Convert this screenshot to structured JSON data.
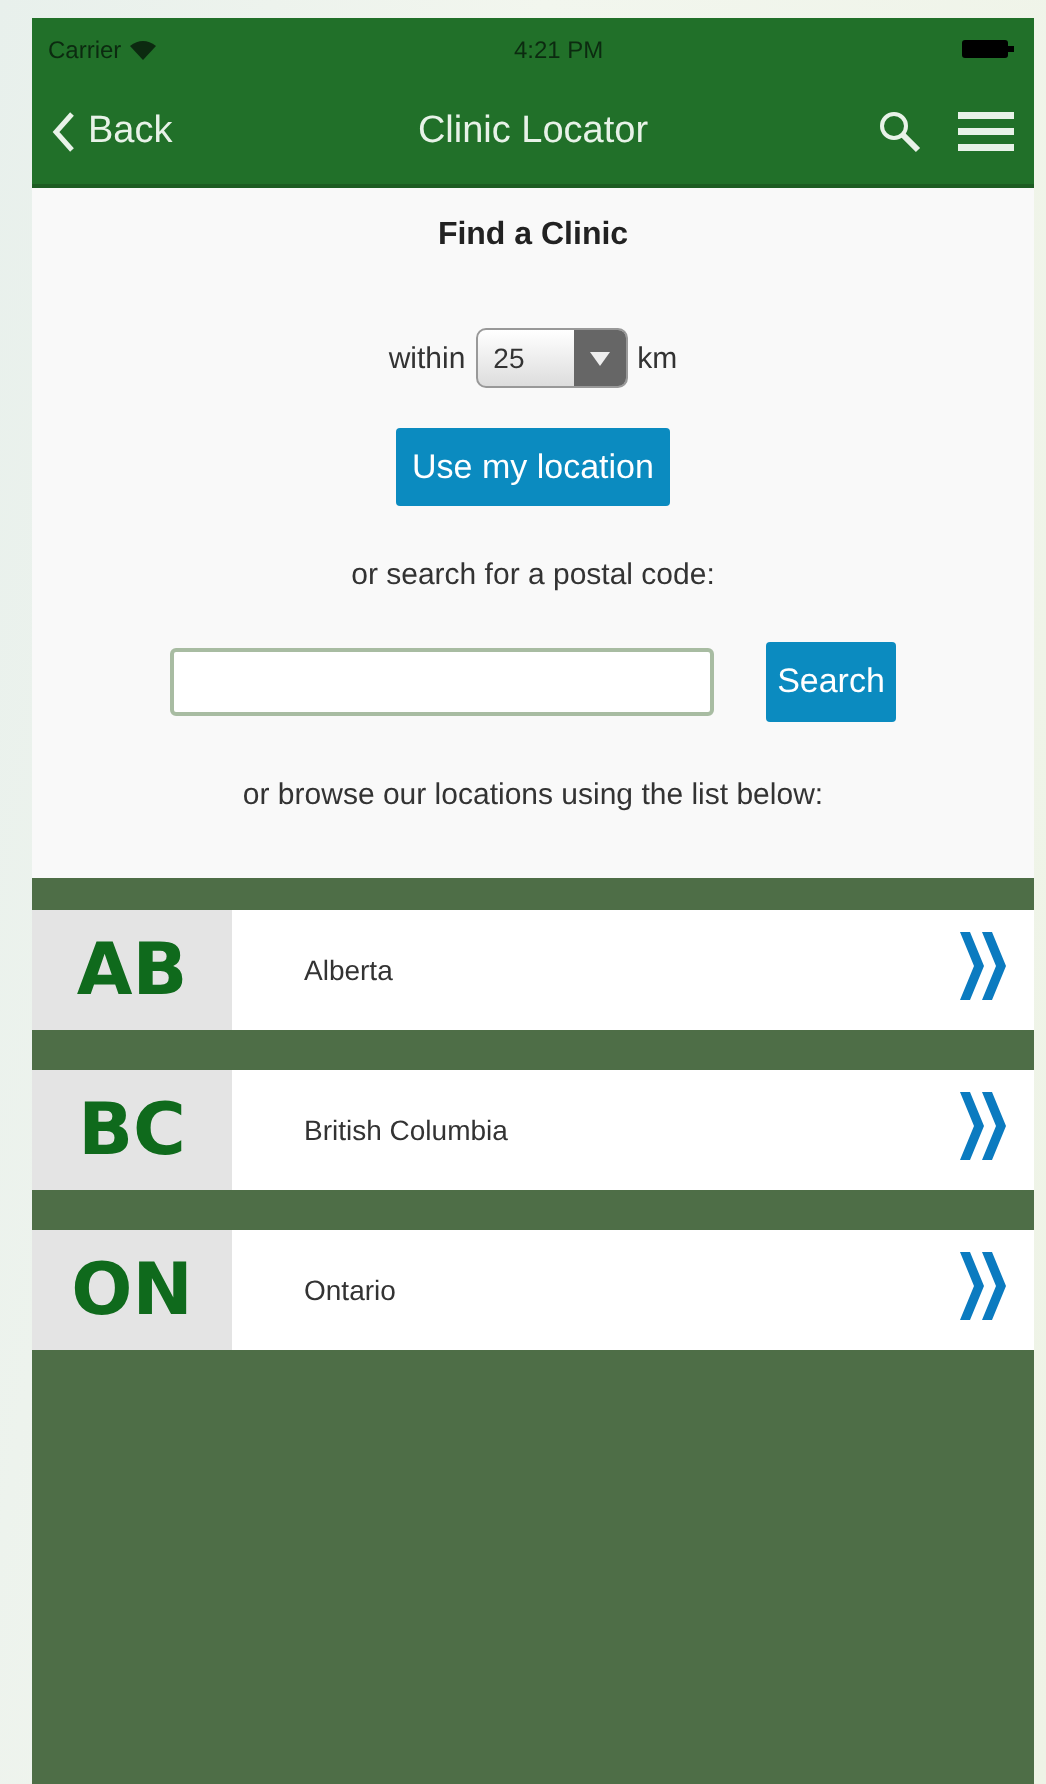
{
  "status_bar": {
    "carrier": "Carrier",
    "time": "4:21 PM"
  },
  "nav_bar": {
    "back": "Back",
    "title": "Clinic Locator"
  },
  "finder": {
    "heading": "Find a Clinic",
    "within_label": "within",
    "distance": "25",
    "unit": "km",
    "location_button": "Use my location",
    "postal_prompt": "or search for a postal code:",
    "search_button": "Search",
    "browse_prompt": "or browse our locations using the list below:"
  },
  "regions": [
    {
      "code": "AB",
      "name": "Alberta"
    },
    {
      "code": "BC",
      "name": "British Columbia"
    },
    {
      "code": "ON",
      "name": "Ontario"
    }
  ]
}
